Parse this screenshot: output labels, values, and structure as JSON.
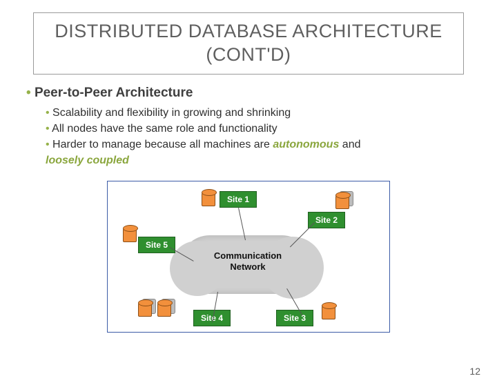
{
  "title": "DISTRIBUTED DATABASE ARCHITECTURE (CONT'D)",
  "heading": "Peer-to-Peer Architecture",
  "bullets": {
    "b1": "Scalability and flexibility in growing and shrinking",
    "b2": "All nodes have the same role and functionality",
    "b3_pre": "Harder to manage because all machines are ",
    "b3_em1": "autonomous",
    "b3_mid": " and ",
    "b3_em2": "loosely coupled"
  },
  "diagram": {
    "cloud_label_l1": "Communication",
    "cloud_label_l2": "Network",
    "site1": "Site 1",
    "site2": "Site 2",
    "site3": "Site 3",
    "site4": "Site 4",
    "site5": "Site 5"
  },
  "page_number": "12"
}
